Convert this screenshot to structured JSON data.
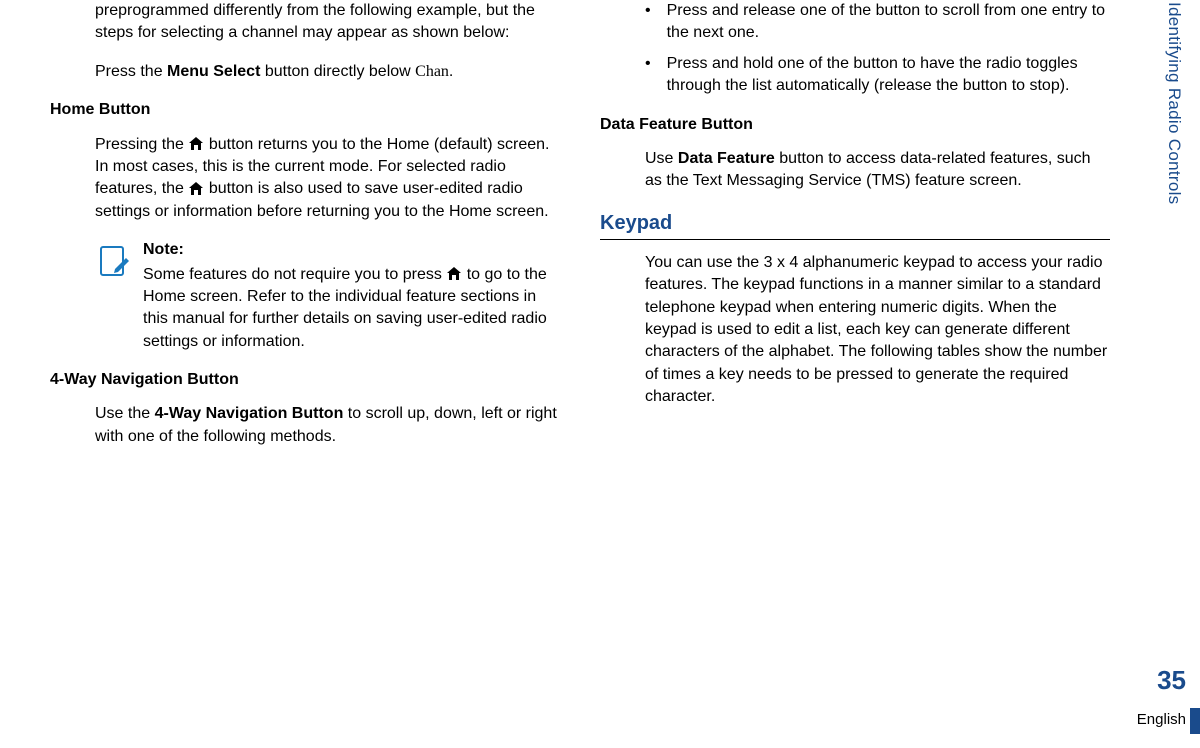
{
  "sideLabel": "Identifying Radio Controls",
  "pageNumber": "35",
  "language": "English",
  "left": {
    "intro": "preprogrammed differently from the following example, but the steps for selecting a channel may appear as shown below:",
    "pressMenu_a": "Press the ",
    "pressMenu_bold": "Menu Select",
    "pressMenu_b": " button directly below ",
    "pressMenu_chan": "Chan",
    "pressMenu_c": ".",
    "homeHeading": "Home Button",
    "homePara1_a": "Pressing the ",
    "homePara1_b": " button returns you to the Home (default) screen. In most cases, this is the current mode. For selected radio features, the ",
    "homePara1_c": " button is also used to save user-edited radio settings or information before returning you to the Home screen.",
    "noteLabel": "Note:",
    "noteBody_a": "Some features do not require you to press ",
    "noteBody_b": " to go to the Home screen. Refer to the individual feature sections in this manual for further details on saving user-edited radio settings or information.",
    "navHeading": "4-Way Navigation Button",
    "navBody_a": "Use the ",
    "navBody_bold": "4-Way Navigation Button",
    "navBody_b": " to scroll up, down, left or right with one of the following methods."
  },
  "right": {
    "bullet1": "Press and release one of the button to scroll from one entry to the next one.",
    "bullet2": "Press and hold one of the button to have the radio toggles through the list automatically (release the button to stop).",
    "dataHeading": "Data Feature Button",
    "dataBody_a": "Use ",
    "dataBody_bold": "Data Feature",
    "dataBody_b": " button to access data-related features, such as the Text Messaging Service (TMS) feature screen.",
    "keypadHeading": "Keypad",
    "keypadBody": "You can use the 3 x 4 alphanumeric keypad to access your radio features. The keypad functions in a manner similar to a standard telephone keypad when entering numeric digits. When the keypad is used to edit a list, each key can generate different characters of the alphabet. The following tables show the number of times a key needs to be pressed to generate the required character."
  }
}
